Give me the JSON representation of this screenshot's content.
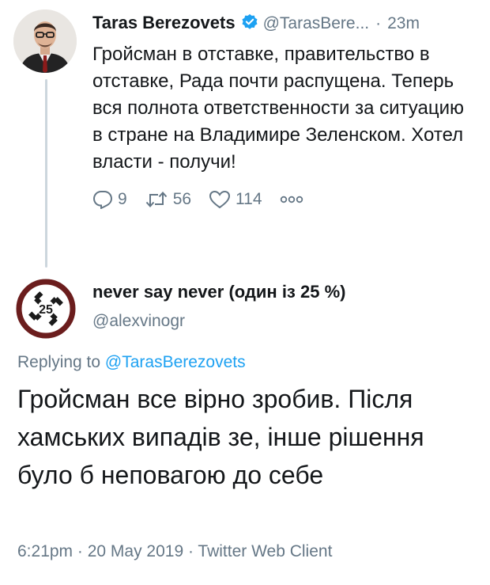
{
  "tweet": {
    "author_name": "Taras Berezovets",
    "author_handle": "@TarasBere...",
    "separator": "·",
    "time": "23m",
    "text": "Гройсман в отставке, правительство в отставке, Рада почти распущена. Теперь вся полнота ответственности за ситуацию в стране на Владимире Зеленском. Хотел власти - получи!",
    "replies": "9",
    "retweets": "56",
    "likes": "114"
  },
  "reply": {
    "author_name": "never say never (один із 25 %)",
    "author_handle": "@alexvinogr",
    "avatar_text": "25",
    "replying_prefix": "Replying to ",
    "replying_to": "@TarasBerezovets",
    "text": "Гройсман все вірно зробив. Після хамських випадів зе, інше рішення було б неповагою до себе",
    "timestamp": "6:21pm · 20 May 2019 · Twitter Web Client"
  },
  "colors": {
    "secondary_text": "#657786",
    "link": "#1da1f2",
    "verified": "#1da1f2",
    "thread_line": "#ccd6dd",
    "avatar2_ring": "#6b1d1d"
  }
}
